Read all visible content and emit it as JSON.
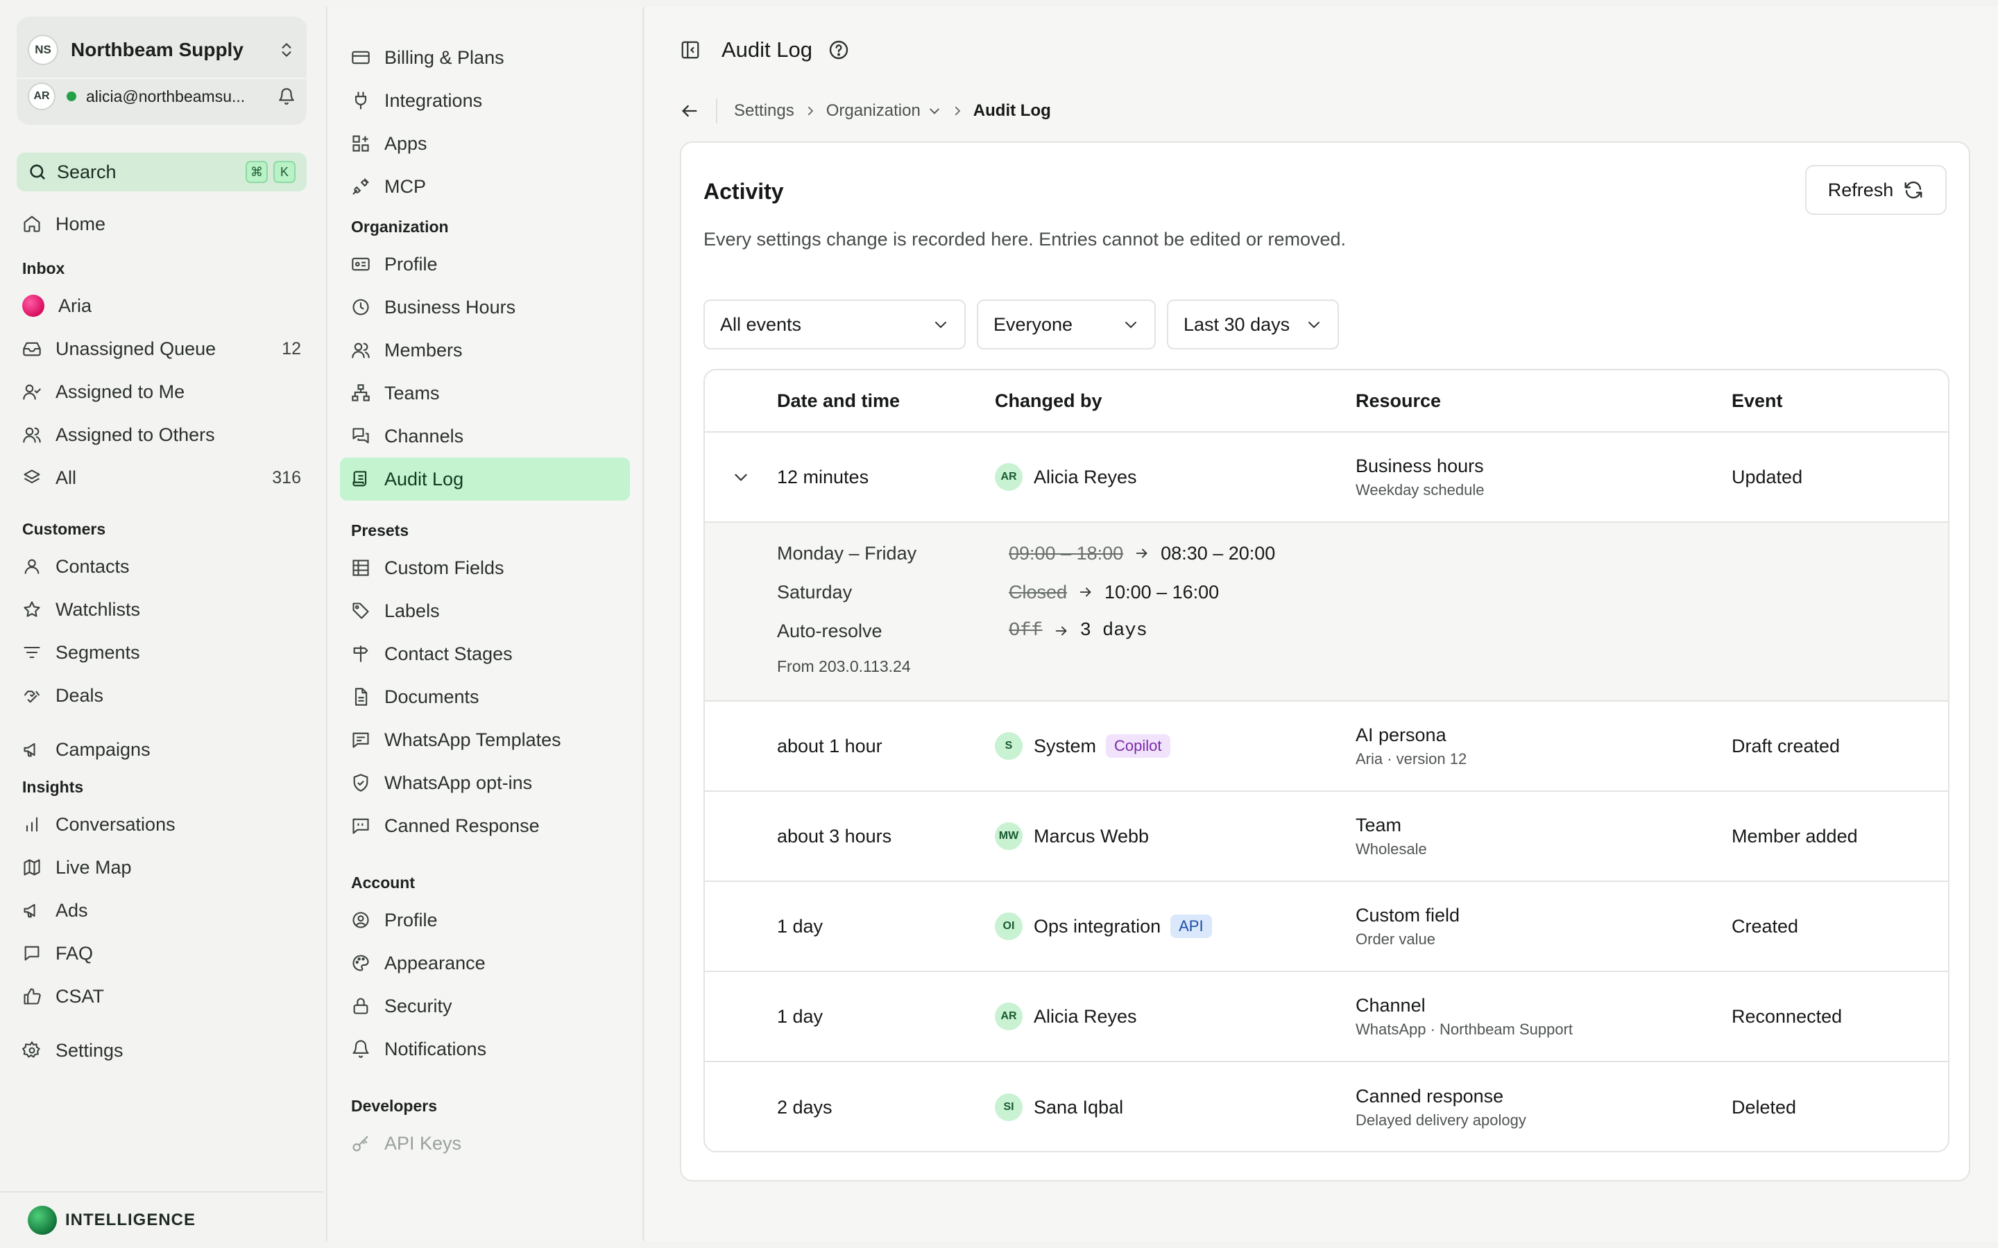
{
  "workspace": {
    "initials": "NS",
    "name": "Northbeam Supply"
  },
  "user": {
    "initials": "AR",
    "email": "alicia@northbeamsu..."
  },
  "search": {
    "label": "Search",
    "kbd1": "⌘",
    "kbd2": "K"
  },
  "sidebar": {
    "home": "Home",
    "inbox_title": "Inbox",
    "inbox": [
      {
        "label": "Aria",
        "count": ""
      },
      {
        "label": "Unassigned Queue",
        "count": "12"
      },
      {
        "label": "Assigned to Me",
        "count": ""
      },
      {
        "label": "Assigned to Others",
        "count": ""
      },
      {
        "label": "All",
        "count": "316"
      }
    ],
    "customers_title": "Customers",
    "customers": [
      "Contacts",
      "Watchlists",
      "Segments",
      "Deals"
    ],
    "campaigns": "Campaigns",
    "insights_title": "Insights",
    "insights": [
      "Conversations",
      "Live Map",
      "Ads",
      "FAQ",
      "CSAT"
    ],
    "settings": "Settings",
    "brand": "INTELLIGENCE"
  },
  "settings_nav": {
    "top": [
      "Billing & Plans",
      "Integrations",
      "Apps",
      "MCP"
    ],
    "organization_title": "Organization",
    "organization": [
      "Profile",
      "Business Hours",
      "Members",
      "Teams",
      "Channels",
      "Audit Log"
    ],
    "presets_title": "Presets",
    "presets": [
      "Custom Fields",
      "Labels",
      "Contact Stages",
      "Documents",
      "WhatsApp Templates",
      "WhatsApp opt-ins",
      "Canned Response"
    ],
    "account_title": "Account",
    "account": [
      "Profile",
      "Appearance",
      "Security",
      "Notifications"
    ],
    "developers_title": "Developers",
    "developers": [
      "API Keys"
    ]
  },
  "page": {
    "title": "Audit Log",
    "breadcrumb": [
      "Settings",
      "Organization",
      "Audit Log"
    ]
  },
  "card": {
    "title": "Activity",
    "description": "Every settings change is recorded here. Entries cannot be edited or removed.",
    "refresh_label": "Refresh"
  },
  "filters": {
    "events": "All events",
    "people": "Everyone",
    "range": "Last 30 days"
  },
  "table": {
    "headers": [
      "Date and time",
      "Changed by",
      "Resource",
      "Event"
    ],
    "rows": [
      {
        "date": "12 minutes",
        "initials": "AR",
        "by": "Alicia Reyes",
        "tag": "",
        "resource": "Business hours",
        "resource_sub": "Weekday schedule",
        "event": "Updated"
      },
      {
        "date": "about 1 hour",
        "initials": "S",
        "by": "System",
        "tag": "Copilot",
        "resource": "AI persona",
        "resource_sub": "Aria · version 12",
        "event": "Draft created"
      },
      {
        "date": "about 3 hours",
        "initials": "MW",
        "by": "Marcus Webb",
        "tag": "",
        "resource": "Team",
        "resource_sub": "Wholesale",
        "event": "Member added"
      },
      {
        "date": "1 day",
        "initials": "OI",
        "by": "Ops integration",
        "tag": "API",
        "resource": "Custom field",
        "resource_sub": "Order value",
        "event": "Created"
      },
      {
        "date": "1 day",
        "initials": "AR",
        "by": "Alicia Reyes",
        "tag": "",
        "resource": "Channel",
        "resource_sub": "WhatsApp · Northbeam Support",
        "event": "Reconnected"
      },
      {
        "date": "2 days",
        "initials": "SI",
        "by": "Sana Iqbal",
        "tag": "",
        "resource": "Canned response",
        "resource_sub": "Delayed delivery apology",
        "event": "Deleted"
      }
    ],
    "detail": {
      "changes": [
        {
          "key": "Monday – Friday",
          "old": "09:00 – 18:00",
          "new": "08:30 – 20:00"
        },
        {
          "key": "Saturday",
          "old": "Closed",
          "new": "10:00 – 16:00"
        },
        {
          "key": "Auto-resolve",
          "old": "Off",
          "new": "3 days"
        }
      ],
      "source": "From 203.0.113.24"
    }
  },
  "colors": {
    "accent": "#c3f3cf",
    "brand": "#24a148",
    "copilot": "#7b2aa8",
    "api": "#1c4fa8"
  }
}
